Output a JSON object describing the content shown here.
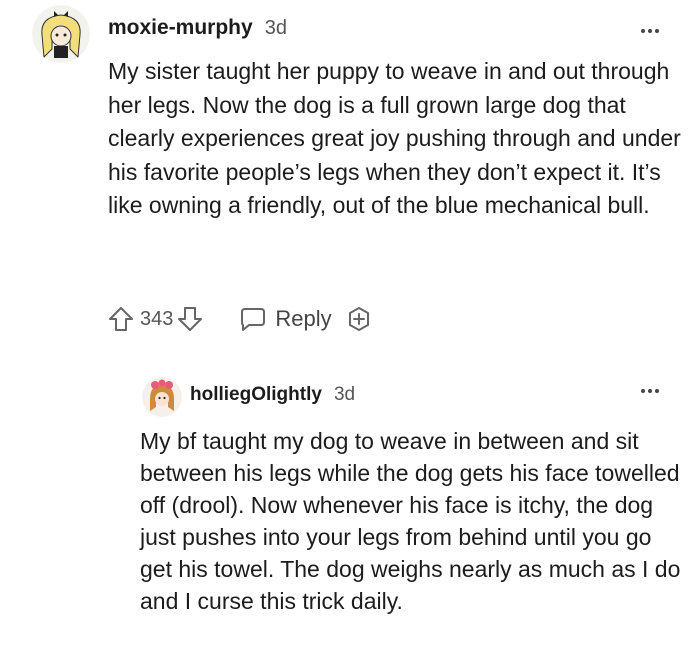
{
  "comments": [
    {
      "username": "moxie-murphy",
      "age": "3d",
      "text": "My sister taught her puppy to weave in and out through her legs. Now the dog is a full grown large dog that clearly experiences great joy pushing through and under his favorite people’s legs when they don’t expect it. It’s like owning a friendly, out of the blue mechanical bull.",
      "votes": "343",
      "reply_label": "Reply",
      "icons": {
        "upvote": "arrow-up-outline-icon",
        "downvote": "arrow-down-outline-icon",
        "reply": "speech-bubble-icon",
        "award": "award-plus-icon",
        "more": "more-horizontal-icon"
      }
    },
    {
      "username": "holliegOlightly",
      "age": "3d",
      "text": "My bf taught my dog to weave in between and sit between his legs while the dog gets his face towelled off (drool). Now whenever his face is itchy, the dog just pushes into your legs from behind until you go get his towel. The dog weighs nearly as much as I do and I curse this trick daily."
    }
  ]
}
